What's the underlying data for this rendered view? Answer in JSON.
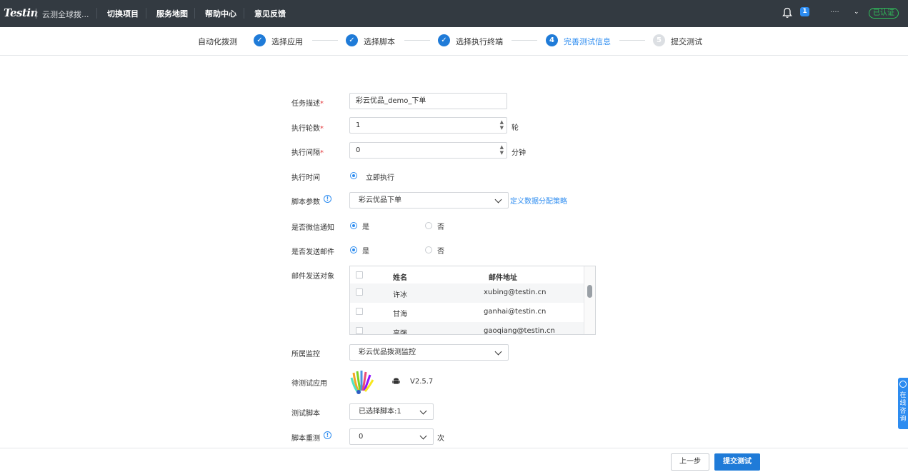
{
  "topbar": {
    "logo": "Testin",
    "brand": "云测全球拨...",
    "nav": [
      "切换项目",
      "服务地图",
      "帮助中心",
      "意见反馈"
    ],
    "notification_count": "1",
    "user_name": "····",
    "verified_label": "已认证"
  },
  "steps": {
    "prefix": "自动化拨测",
    "items": [
      {
        "label": "选择应用",
        "status": "done",
        "marker": "✓"
      },
      {
        "label": "选择脚本",
        "status": "done",
        "marker": "✓"
      },
      {
        "label": "选择执行终端",
        "status": "done",
        "marker": "✓"
      },
      {
        "label": "完善测试信息",
        "status": "current",
        "marker": "4"
      },
      {
        "label": "提交测试",
        "status": "pending",
        "marker": "5"
      }
    ]
  },
  "form": {
    "task_desc": {
      "label": "任务描述",
      "value": "彩云优品_demo_下单"
    },
    "rounds": {
      "label": "执行轮数",
      "value": "1",
      "unit": "轮"
    },
    "interval": {
      "label": "执行间隔",
      "value": "0",
      "unit": "分钟"
    },
    "exec_time": {
      "label": "执行时间",
      "option": "立即执行"
    },
    "script_params": {
      "label": "脚本参数",
      "value": "彩云优品下单",
      "link": "定义数据分配策略"
    },
    "wechat_notify": {
      "label": "是否微信通知",
      "yes": "是",
      "no": "否"
    },
    "send_mail": {
      "label": "是否发送邮件",
      "yes": "是",
      "no": "否"
    },
    "mail_targets": {
      "label": "邮件发送对象",
      "columns": [
        "姓名",
        "邮件地址"
      ],
      "rows": [
        {
          "name": "许冰",
          "email": "xubing@testin.cn"
        },
        {
          "name": "甘海",
          "email": "ganhai@testin.cn"
        },
        {
          "name": "高强",
          "email": "gaoqiang@testin.cn"
        }
      ]
    },
    "monitor": {
      "label": "所属监控",
      "value": "彩云优品拨测监控"
    },
    "app": {
      "label": "待测试应用",
      "version": "V2.5.7"
    },
    "test_script": {
      "label": "测试脚本",
      "value": "已选择脚本:1"
    },
    "retry": {
      "label": "脚本重测",
      "value": "0",
      "unit": "次"
    }
  },
  "footer": {
    "prev": "上一步",
    "submit": "提交测试"
  },
  "consult": {
    "label": "在线咨询"
  },
  "colors": {
    "primary": "#2d8cf0",
    "topbar": "#333a41",
    "verified": "#2fc25b"
  }
}
